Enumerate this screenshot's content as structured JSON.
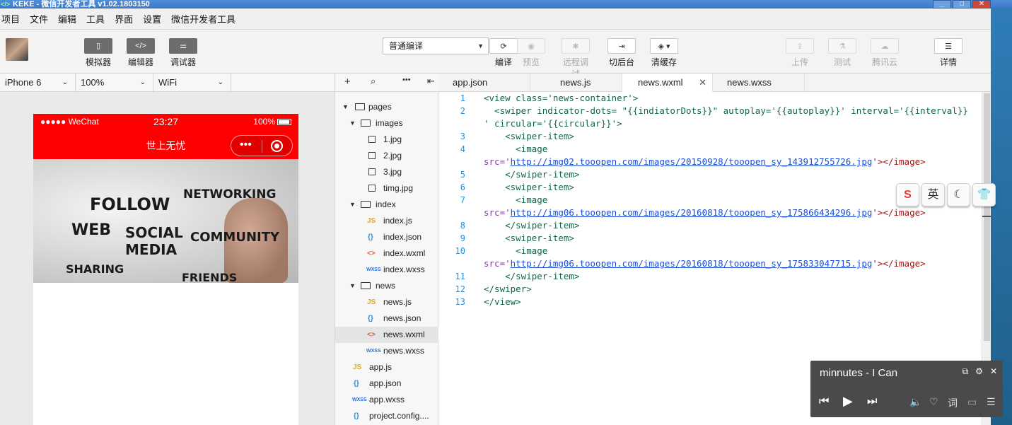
{
  "window": {
    "title": "KEKE - 微信开发者工具 v1.02.1803150",
    "controls": [
      "_",
      "□",
      "✕"
    ]
  },
  "menu": [
    "项目",
    "文件",
    "编辑",
    "工具",
    "界面",
    "设置",
    "微信开发者工具"
  ],
  "toolbar": {
    "simulator_label": "模拟器",
    "editor_label": "编辑器",
    "debugger_label": "调试器",
    "compile_mode": "普通编译",
    "compile_label": "编译",
    "preview_label": "预览",
    "remote_debug_label": "远程调试",
    "background_label": "切后台",
    "clear_cache_label": "清缓存",
    "upload_label": "上传",
    "test_label": "测试",
    "tencent_cloud_label": "腾讯云",
    "details_label": "详情"
  },
  "device_bar": {
    "device": "iPhone 6",
    "zoom": "100%",
    "network": "WiFi"
  },
  "phone": {
    "carrier": "●●●●● WeChat",
    "time": "23:27",
    "battery": "100%",
    "nav_title": "世上无忧",
    "capsule_dots": "•••"
  },
  "banner_words": [
    "FOLLOW",
    "NETWORKING",
    "WEB",
    "SOCIAL",
    "MEDIA",
    "COMMUNITY",
    "SHARING",
    "FRIENDS"
  ],
  "file_tree": [
    {
      "label": "pages",
      "type": "folder",
      "depth": 0
    },
    {
      "label": "images",
      "type": "folder",
      "depth": 1
    },
    {
      "label": "1.jpg",
      "type": "img",
      "depth": 2
    },
    {
      "label": "2.jpg",
      "type": "img",
      "depth": 2
    },
    {
      "label": "3.jpg",
      "type": "img",
      "depth": 2
    },
    {
      "label": "timg.jpg",
      "type": "img",
      "depth": 2
    },
    {
      "label": "index",
      "type": "folder",
      "depth": 1
    },
    {
      "label": "index.js",
      "type": "js",
      "depth": 2
    },
    {
      "label": "index.json",
      "type": "json",
      "depth": 2
    },
    {
      "label": "index.wxml",
      "type": "wxml",
      "depth": 2
    },
    {
      "label": "index.wxss",
      "type": "wxss",
      "depth": 2
    },
    {
      "label": "news",
      "type": "folder",
      "depth": 1
    },
    {
      "label": "news.js",
      "type": "js",
      "depth": 2
    },
    {
      "label": "news.json",
      "type": "json",
      "depth": 2
    },
    {
      "label": "news.wxml",
      "type": "wxml",
      "depth": 2,
      "selected": true
    },
    {
      "label": "news.wxss",
      "type": "wxss",
      "depth": 2
    },
    {
      "label": "app.js",
      "type": "js",
      "depth": 0
    },
    {
      "label": "app.json",
      "type": "json",
      "depth": 0
    },
    {
      "label": "app.wxss",
      "type": "wxss",
      "depth": 0
    },
    {
      "label": "project.config....",
      "type": "json",
      "depth": 0
    }
  ],
  "tabs": [
    {
      "label": "app.json",
      "active": false
    },
    {
      "label": "news.js",
      "active": false
    },
    {
      "label": "news.wxml",
      "active": true
    },
    {
      "label": "news.wxss",
      "active": false
    }
  ],
  "code": {
    "line_numbers": [
      "1",
      "2",
      "3",
      "4",
      "5",
      "6",
      "7",
      "8",
      "9",
      "10",
      "11",
      "12",
      "13"
    ],
    "view_open": "<view class='news-container'>",
    "swiper_open_a": "  <swiper indicator-dots= \"{{indiatorDots}}\" autoplay='{{autoplay}}' interval='{{interval}}",
    "swiper_open_b": "' circular='{{circular}}'>",
    "item_open": "    <swiper-item>",
    "image_open": "      <image",
    "src_prefix": "src='",
    "url1": "http://img02.tooopen.com/images/20150928/tooopen_sy_143912755726.jpg",
    "url2": "http://img06.tooopen.com/images/20160818/tooopen_sy_175866434296.jpg",
    "url3": "http://img06.tooopen.com/images/20160818/tooopen_sy_175833047715.jpg",
    "src_suffix": "'></image>",
    "item_close": "    </swiper-item>",
    "swiper_close": "</swiper>",
    "view_close": "</view>"
  },
  "ime": [
    "S",
    "英",
    "☾",
    "👕"
  ],
  "player": {
    "song": "minnutes - I Can",
    "lyric_label": "词"
  }
}
